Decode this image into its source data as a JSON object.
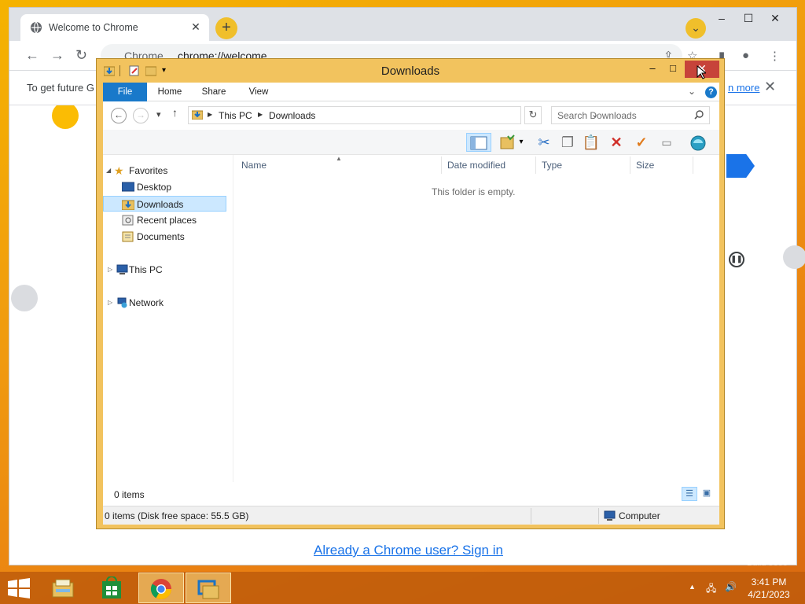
{
  "chrome": {
    "tab_title": "Welcome to Chrome",
    "tab_close": "✕",
    "new_tab": "+",
    "window_controls": {
      "minimize": "–",
      "maximize": "☐",
      "close": "✕"
    },
    "omnibox_chip": "Chrome",
    "url": "chrome://welcome",
    "infobar_message": "To get future G",
    "infobar_link": "n more",
    "infobar_close": "✕",
    "signin_link": "Already a Chrome user? Sign in"
  },
  "explorer": {
    "title": "Downloads",
    "ribbon_tabs": [
      "File",
      "Home",
      "Share",
      "View"
    ],
    "breadcrumb": [
      "This PC",
      "Downloads"
    ],
    "search_placeholder": "Search Downloads",
    "nav": {
      "favorites": "Favorites",
      "desktop": "Desktop",
      "downloads": "Downloads",
      "recent": "Recent places",
      "documents": "Documents",
      "this_pc": "This PC",
      "network": "Network"
    },
    "columns": [
      "Name",
      "Date modified",
      "Type",
      "Size"
    ],
    "empty_message": "This folder is empty.",
    "item_count": "0 items",
    "disk_status": "0 items (Disk free space: 55.5 GB)",
    "location": "Computer"
  },
  "taskbar": {
    "time": "3:41 PM",
    "date": "4/21/2023"
  },
  "colors": {
    "desktop_accent": "#f2a20a",
    "explorer_frame": "#f2c35e",
    "file_tab": "#1979ca",
    "link_blue": "#1a73e8",
    "close_red": "#c7433a"
  },
  "icons": [
    "globe-icon",
    "back-icon",
    "forward-icon",
    "reload-icon",
    "share-icon",
    "star-icon",
    "profile-icon",
    "menu-icon",
    "folder-icon",
    "refresh-icon",
    "search-icon",
    "cut-icon",
    "copy-icon",
    "paste-icon",
    "delete-icon",
    "check-icon",
    "rename-icon",
    "properties-icon",
    "desktop-icon",
    "computer-icon",
    "network-icon",
    "windows-start-icon",
    "chrome-icon",
    "store-icon",
    "file-explorer-icon"
  ]
}
